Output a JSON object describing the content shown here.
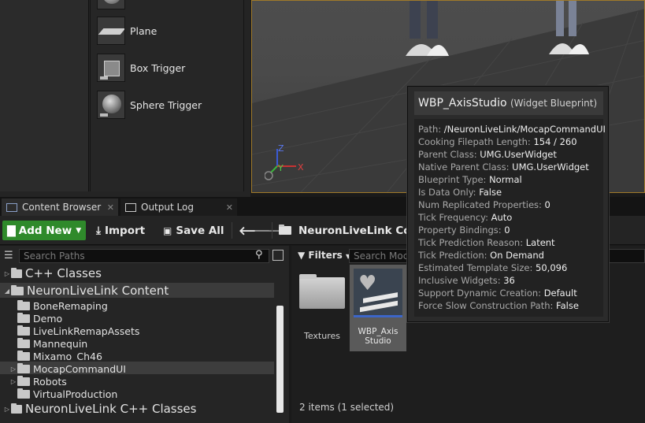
{
  "place_actors": {
    "items": [
      {
        "label": "",
        "icon": "sphere-icon"
      },
      {
        "label": "Plane",
        "icon": "plane-icon"
      },
      {
        "label": "Box Trigger",
        "icon": "box-trigger-icon"
      },
      {
        "label": "Sphere Trigger",
        "icon": "sphere-trigger-icon"
      }
    ]
  },
  "viewport": {
    "axis": {
      "z": "Z",
      "y": "Y",
      "x": "X"
    }
  },
  "tabs": [
    {
      "label": "Content Browser",
      "icon": "content-browser-icon"
    },
    {
      "label": "Output Log",
      "icon": "output-log-icon"
    }
  ],
  "toolbar": {
    "add_new": "Add New",
    "import": "Import",
    "save_all": "Save All",
    "path": "NeuronLiveLink Cont"
  },
  "sources": {
    "search_placeholder": "Search Paths",
    "tree": [
      {
        "label": "C++ Classes",
        "level": 0,
        "arrow": "collapsed",
        "icon": "cpp-folder-icon"
      },
      {
        "label": "NeuronLiveLink Content",
        "level": 0,
        "arrow": "expanded",
        "icon": "folder-open-icon"
      },
      {
        "label": "BoneRemaping",
        "level": 1,
        "arrow": "",
        "icon": "folder-icon"
      },
      {
        "label": "Demo",
        "level": 1,
        "arrow": "",
        "icon": "folder-icon"
      },
      {
        "label": "LiveLinkRemapAssets",
        "level": 1,
        "arrow": "",
        "icon": "folder-icon"
      },
      {
        "label": "Mannequin",
        "level": 1,
        "arrow": "",
        "icon": "folder-icon"
      },
      {
        "label": "Mixamo_Ch46",
        "level": 1,
        "arrow": "",
        "icon": "folder-icon"
      },
      {
        "label": "MocapCommandUI",
        "level": 1,
        "arrow": "collapsed",
        "icon": "folder-icon",
        "selected": true
      },
      {
        "label": "Robots",
        "level": 1,
        "arrow": "collapsed",
        "icon": "folder-icon"
      },
      {
        "label": "VirtualProduction",
        "level": 1,
        "arrow": "",
        "icon": "folder-icon"
      },
      {
        "label": "NeuronLiveLink C++ Classes",
        "level": 0,
        "arrow": "collapsed",
        "icon": "cpp-folder-icon"
      }
    ]
  },
  "assets": {
    "filters_label": "Filters",
    "search_placeholder": "Search Moca",
    "items": [
      {
        "label": "Textures",
        "type": "folder"
      },
      {
        "label_line1": "WBP_Axis",
        "label_line2": "Studio",
        "type": "widget-blueprint"
      }
    ],
    "status": "2 items (1 selected)"
  },
  "tooltip": {
    "title": "WBP_AxisStudio",
    "subtitle": "(Widget Blueprint)",
    "rows": [
      {
        "key": "Path:",
        "value": "/NeuronLiveLink/MocapCommandUI"
      },
      {
        "key": "Cooking Filepath Length:",
        "value": "154 / 260"
      },
      {
        "key": "Parent Class:",
        "value": "UMG.UserWidget"
      },
      {
        "key": "Native Parent Class:",
        "value": "UMG.UserWidget"
      },
      {
        "key": "Blueprint Type:",
        "value": "Normal"
      },
      {
        "key": "Is Data Only:",
        "value": "False"
      },
      {
        "key": "Num Replicated Properties:",
        "value": "0"
      },
      {
        "key": "Tick Frequency:",
        "value": "Auto"
      },
      {
        "key": "Property Bindings:",
        "value": "0"
      },
      {
        "key": "Tick Prediction Reason:",
        "value": "Latent"
      },
      {
        "key": "Tick Prediction:",
        "value": "On Demand"
      },
      {
        "key": "Estimated Template Size:",
        "value": "50,096"
      },
      {
        "key": "Inclusive Widgets:",
        "value": "36"
      },
      {
        "key": "Support Dynamic Creation:",
        "value": "Default"
      },
      {
        "key": "Force Slow Construction Path:",
        "value": "False"
      }
    ]
  },
  "colors": {
    "add_new_bg": "#2f8a2b",
    "viewport_border": "#a07a2a",
    "selection": "#3d3d3d"
  }
}
